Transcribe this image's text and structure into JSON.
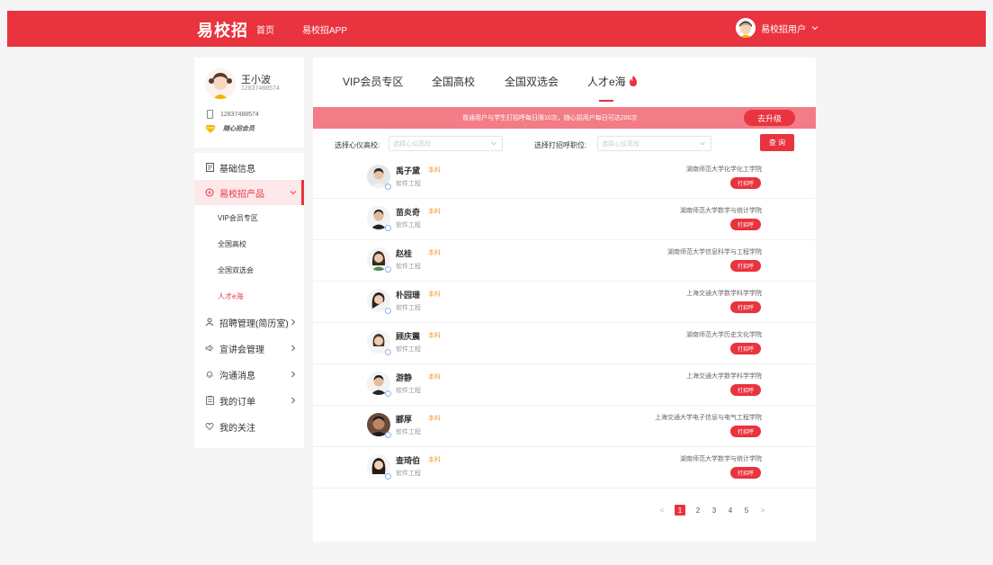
{
  "header": {
    "brand": "易校招",
    "nav_home": "首页",
    "nav_app": "易校招APP",
    "user_name": "易校招用户"
  },
  "profile": {
    "name": "王小波",
    "id": "12837488574",
    "phone": "12837488574",
    "member": "随心招会员"
  },
  "menu": {
    "basic_info": "基础信息",
    "product": "易校招产品",
    "sub_vip": "VIP会员专区",
    "sub_universities": "全国高校",
    "sub_fairs": "全国双选会",
    "sub_talent": "人才e海",
    "recruit": "招聘管理(简历室)",
    "seminar": "宣讲会管理",
    "messages": "沟通消息",
    "orders": "我的订单",
    "follow": "我的关注"
  },
  "tabs": [
    "VIP会员专区",
    "全国高校",
    "全国双选会",
    "人才e海"
  ],
  "notice": {
    "text": "普通用户与学生打招呼每日限10次，随心招用户每日可达200次",
    "upgrade": "去升级"
  },
  "filters": {
    "school_label": "选择心仪高校:",
    "school_placeholder": "选择心仪高校",
    "position_label": "选择打招呼职位:",
    "position_placeholder": "选择心仪高校",
    "query": "查 询"
  },
  "greet_label": "打招呼",
  "candidates": [
    {
      "name": "禹子黛",
      "degree": "本科",
      "major": "软件工程",
      "school": "湖南师范大学化学化工学院"
    },
    {
      "name": "苗炎奇",
      "degree": "本科",
      "major": "软件工程",
      "school": "湖南师范大学数学与统计学院"
    },
    {
      "name": "赵桂",
      "degree": "本科",
      "major": "软件工程",
      "school": "湖南师范大学信息科学与工程学院"
    },
    {
      "name": "朴园珊",
      "degree": "本科",
      "major": "软件工程",
      "school": "上海交通大学数学科学学院"
    },
    {
      "name": "顾庆震",
      "degree": "本科",
      "major": "软件工程",
      "school": "湖南师范大学历史文化学院"
    },
    {
      "name": "游静",
      "degree": "本科",
      "major": "软件工程",
      "school": "上海交通大学数学科学学院"
    },
    {
      "name": "郦厚",
      "degree": "本科",
      "major": "软件工程",
      "school": "上海交通大学电子信息与电气工程学院"
    },
    {
      "name": "查琦伯",
      "degree": "本科",
      "major": "软件工程",
      "school": "湖南师范大学数学与统计学院"
    }
  ],
  "pagination": {
    "prev": "<",
    "pages": [
      "1",
      "2",
      "3",
      "4",
      "5"
    ],
    "current": "1",
    "next": ">"
  },
  "colors": {
    "accent": "#e9333f",
    "notice_bg": "#f27d86",
    "degree": "#f39a2b"
  }
}
